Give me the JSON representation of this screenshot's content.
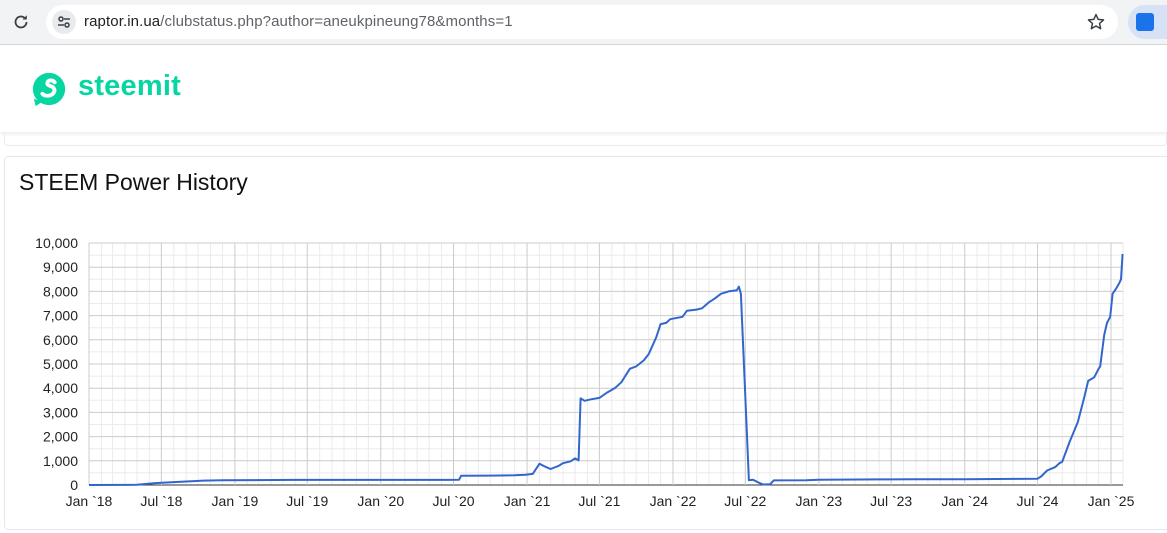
{
  "browser": {
    "url_host": "raptor.in.ua",
    "url_path": "/clubstatus.php?author=aneukpineung78&months=1",
    "icons": [
      "reload-icon",
      "site-info-icon",
      "bookmark-star-icon",
      "extension-icon"
    ]
  },
  "site": {
    "brand": "steemit",
    "brand_color": "#07d6a2"
  },
  "card": {
    "title": "STEEM Power History"
  },
  "chart_data": {
    "type": "line",
    "title": "STEEM Power History",
    "xlabel": "",
    "ylabel": "",
    "ylim": [
      0,
      10000
    ],
    "yticks": [
      "0",
      "1,000",
      "2,000",
      "3,000",
      "4,000",
      "5,000",
      "6,000",
      "7,000",
      "8,000",
      "9,000",
      "10,000"
    ],
    "xlim": [
      "2018-01-01",
      "2025-01-31"
    ],
    "xticks": [
      "Jan `18",
      "Jul `18",
      "Jan `19",
      "Jul `19",
      "Jan `20",
      "Jul `20",
      "Jan `21",
      "Jul `21",
      "Jan `22",
      "Jul `22",
      "Jan `23",
      "Jul `23",
      "Jan `24",
      "Jul `24",
      "Jan `25"
    ],
    "grid": true,
    "line_color": "#3366cc",
    "series": [
      {
        "points": [
          [
            "2018-01-01",
            0
          ],
          [
            "2018-05-01",
            10
          ],
          [
            "2018-06-15",
            80
          ],
          [
            "2018-08-01",
            120
          ],
          [
            "2018-10-15",
            180
          ],
          [
            "2018-12-01",
            200
          ],
          [
            "2019-06-01",
            210
          ],
          [
            "2019-12-01",
            210
          ],
          [
            "2020-06-15",
            210
          ],
          [
            "2020-07-15",
            220
          ],
          [
            "2020-07-20",
            380
          ],
          [
            "2020-10-01",
            390
          ],
          [
            "2020-12-01",
            400
          ],
          [
            "2020-12-28",
            420
          ],
          [
            "2021-01-15",
            460
          ],
          [
            "2021-02-01",
            880
          ],
          [
            "2021-02-15",
            760
          ],
          [
            "2021-03-01",
            660
          ],
          [
            "2021-03-20",
            780
          ],
          [
            "2021-04-01",
            900
          ],
          [
            "2021-04-20",
            980
          ],
          [
            "2021-05-01",
            1100
          ],
          [
            "2021-05-10",
            1020
          ],
          [
            "2021-05-15",
            3580
          ],
          [
            "2021-05-25",
            3480
          ],
          [
            "2021-06-10",
            3540
          ],
          [
            "2021-07-01",
            3600
          ],
          [
            "2021-07-20",
            3820
          ],
          [
            "2021-08-10",
            4020
          ],
          [
            "2021-08-25",
            4250
          ],
          [
            "2021-09-15",
            4800
          ],
          [
            "2021-10-01",
            4900
          ],
          [
            "2021-10-20",
            5150
          ],
          [
            "2021-11-01",
            5400
          ],
          [
            "2021-11-20",
            6100
          ],
          [
            "2021-12-01",
            6650
          ],
          [
            "2021-12-15",
            6700
          ],
          [
            "2021-12-25",
            6850
          ],
          [
            "2022-01-25",
            6950
          ],
          [
            "2022-02-05",
            7200
          ],
          [
            "2022-03-01",
            7250
          ],
          [
            "2022-03-15",
            7300
          ],
          [
            "2022-04-01",
            7550
          ],
          [
            "2022-04-15",
            7700
          ],
          [
            "2022-05-01",
            7900
          ],
          [
            "2022-05-20",
            8000
          ],
          [
            "2022-06-10",
            8050
          ],
          [
            "2022-06-15",
            8200
          ],
          [
            "2022-06-20",
            7900
          ],
          [
            "2022-07-10",
            200
          ],
          [
            "2022-07-20",
            220
          ],
          [
            "2022-08-01",
            120
          ],
          [
            "2022-08-10",
            50
          ],
          [
            "2022-08-15",
            20
          ],
          [
            "2022-09-01",
            30
          ],
          [
            "2022-09-10",
            190
          ],
          [
            "2022-12-01",
            200
          ],
          [
            "2023-01-01",
            220
          ],
          [
            "2023-06-01",
            230
          ],
          [
            "2023-09-01",
            240
          ],
          [
            "2024-01-01",
            240
          ],
          [
            "2024-05-01",
            250
          ],
          [
            "2024-07-01",
            260
          ],
          [
            "2024-07-10",
            350
          ],
          [
            "2024-07-25",
            600
          ],
          [
            "2024-08-15",
            750
          ],
          [
            "2024-08-25",
            900
          ],
          [
            "2024-09-01",
            960
          ],
          [
            "2024-09-20",
            1800
          ],
          [
            "2024-10-10",
            2600
          ],
          [
            "2024-10-25",
            3550
          ],
          [
            "2024-11-05",
            4300
          ],
          [
            "2024-11-20",
            4450
          ],
          [
            "2024-12-01",
            4800
          ],
          [
            "2024-12-05",
            4900
          ],
          [
            "2024-12-15",
            6200
          ],
          [
            "2024-12-22",
            6700
          ],
          [
            "2024-12-30",
            6950
          ],
          [
            "2025-01-05",
            7900
          ],
          [
            "2025-01-15",
            8150
          ],
          [
            "2025-01-22",
            8350
          ],
          [
            "2025-01-26",
            8500
          ],
          [
            "2025-01-30",
            9550
          ]
        ]
      }
    ]
  }
}
